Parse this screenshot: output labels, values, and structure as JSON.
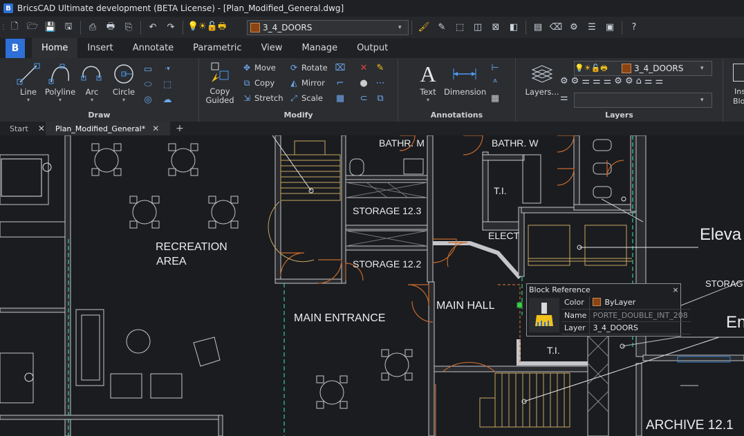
{
  "window": {
    "title": "BricsCAD Ultimate development (BETA License) - [Plan_Modified_General.dwg]"
  },
  "quick_access": {
    "current_layer": "3_4_DOORS",
    "layer_color": "#8a4512"
  },
  "ribbon_tabs": [
    "Home",
    "Insert",
    "Annotate",
    "Parametric",
    "View",
    "Manage",
    "Output"
  ],
  "ribbon": {
    "draw": {
      "title": "Draw",
      "line": "Line",
      "polyline": "Polyline",
      "arc": "Arc",
      "circle": "Circle"
    },
    "modify": {
      "title": "Modify",
      "copy_guided": "Copy Guided",
      "move": "Move",
      "copy": "Copy",
      "stretch": "Stretch",
      "rotate": "Rotate",
      "mirror": "Mirror",
      "scale": "Scale"
    },
    "annotations": {
      "title": "Annotations",
      "text": "Text",
      "dimension": "Dimension"
    },
    "layers": {
      "title": "Layers",
      "layers_btn": "Layers...",
      "current_layer": "3_4_DOORS"
    },
    "insert": {
      "label": "Ins",
      "label2": "Blo"
    }
  },
  "doc_tabs": {
    "start": "Start",
    "current": "Plan_Modified_General*",
    "add": "+"
  },
  "drawing_labels": {
    "bathr_m": "BATHR. M",
    "bathr_w": "BATHR. W",
    "ti_1": "T.I.",
    "storage_123": "STORAGE 12.3",
    "elect": "ELECT",
    "elevator": "Eleva",
    "recreation": "RECREATION",
    "area": "AREA",
    "storage_122": "STORAGE 12.2",
    "storage_right": "STORAG",
    "main_hall": "MAIN HALL",
    "main_entrance": "MAIN ENTRANCE",
    "en": "En",
    "ti_2": "T.I.",
    "archive": "ARCHIVE 12.1"
  },
  "block_reference": {
    "title": "Block Reference",
    "close": "×",
    "rows": [
      {
        "key": "Color",
        "value": "ByLayer"
      },
      {
        "key": "Name",
        "value": "PORTE_DOUBLE_INT_208"
      },
      {
        "key": "Layer",
        "value": "3_4_DOORS"
      }
    ]
  }
}
